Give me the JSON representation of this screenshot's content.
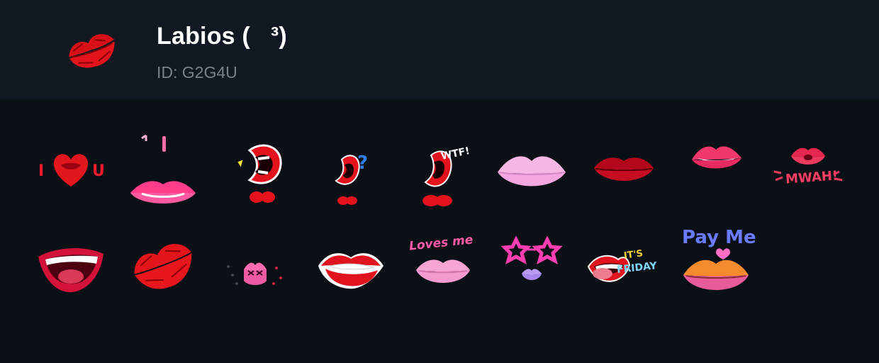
{
  "pack": {
    "title": "Labios (   ³)",
    "id_text": "ID: G2G4U"
  },
  "stickers": [
    {
      "name": "i-heart-u-lips",
      "icon": "heart-lips-icon",
      "text": [
        "I",
        "U"
      ]
    },
    {
      "name": "pink-lips-rain",
      "icon": "pink-lips-icon"
    },
    {
      "name": "red-mouth-yell",
      "icon": "red-mouth-character-icon"
    },
    {
      "name": "red-mouth-question",
      "icon": "red-mouth-question-icon",
      "text": [
        "?"
      ]
    },
    {
      "name": "red-mouth-wtf",
      "icon": "red-mouth-wtf-icon",
      "text": [
        "WTF!"
      ]
    },
    {
      "name": "pale-pink-lips",
      "icon": "pale-pink-lips-icon"
    },
    {
      "name": "dark-red-lips",
      "icon": "dark-red-lips-icon"
    },
    {
      "name": "pink-smile-lips",
      "icon": "pink-smile-lips-icon"
    },
    {
      "name": "mwah-kiss",
      "icon": "mwah-kiss-icon",
      "text": [
        "MWAH!"
      ]
    },
    {
      "name": "laughing-mouth",
      "icon": "laughing-mouth-icon"
    },
    {
      "name": "red-kiss-print",
      "icon": "kiss-print-icon"
    },
    {
      "name": "tiny-lips-confetti",
      "icon": "lips-confetti-icon"
    },
    {
      "name": "lip-bite",
      "icon": "lip-bite-icon"
    },
    {
      "name": "loves-me-lips",
      "icon": "loves-me-lips-icon",
      "text": [
        "Loves me"
      ]
    },
    {
      "name": "star-glasses-lips",
      "icon": "star-glasses-icon"
    },
    {
      "name": "its-friday-tongue",
      "icon": "tongue-friday-icon",
      "text": [
        "IT'S",
        "FRIDAY"
      ]
    },
    {
      "name": "pay-me-lips",
      "icon": "pay-me-lips-icon",
      "text": [
        "Pay Me"
      ]
    }
  ],
  "colors": {
    "header_bg": "#121821",
    "body_bg": "#0b1017",
    "id_text": "#7a818b",
    "lip_red": "#e0131e",
    "lip_pink": "#ff4f9a"
  }
}
